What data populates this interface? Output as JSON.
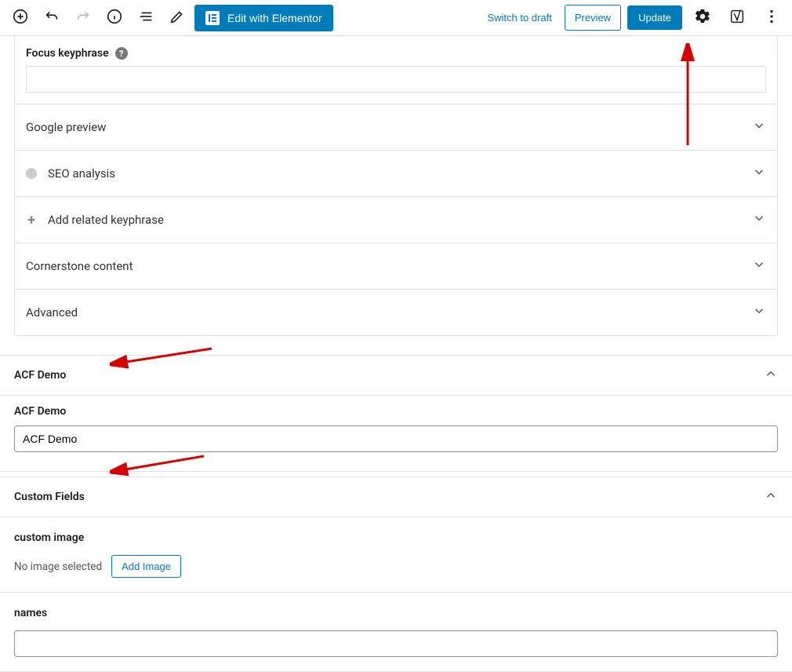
{
  "toolbar": {
    "elementor_label": "Edit with Elementor",
    "switch_draft_label": "Switch to draft",
    "preview_label": "Preview",
    "update_label": "Update"
  },
  "yoast": {
    "focus_label": "Focus keyphrase",
    "rows": {
      "google_preview": "Google preview",
      "seo_analysis": "SEO analysis",
      "add_related": "Add related keyphrase",
      "cornerstone": "Cornerstone content",
      "advanced": "Advanced"
    }
  },
  "acf": {
    "panel_title": "ACF Demo",
    "field_label": "ACF Demo",
    "field_value": "ACF Demo"
  },
  "custom_fields": {
    "panel_title": "Custom Fields",
    "image_field_label": "custom image",
    "no_image_text": "No image selected",
    "add_image_label": "Add Image",
    "names_label": "names"
  }
}
